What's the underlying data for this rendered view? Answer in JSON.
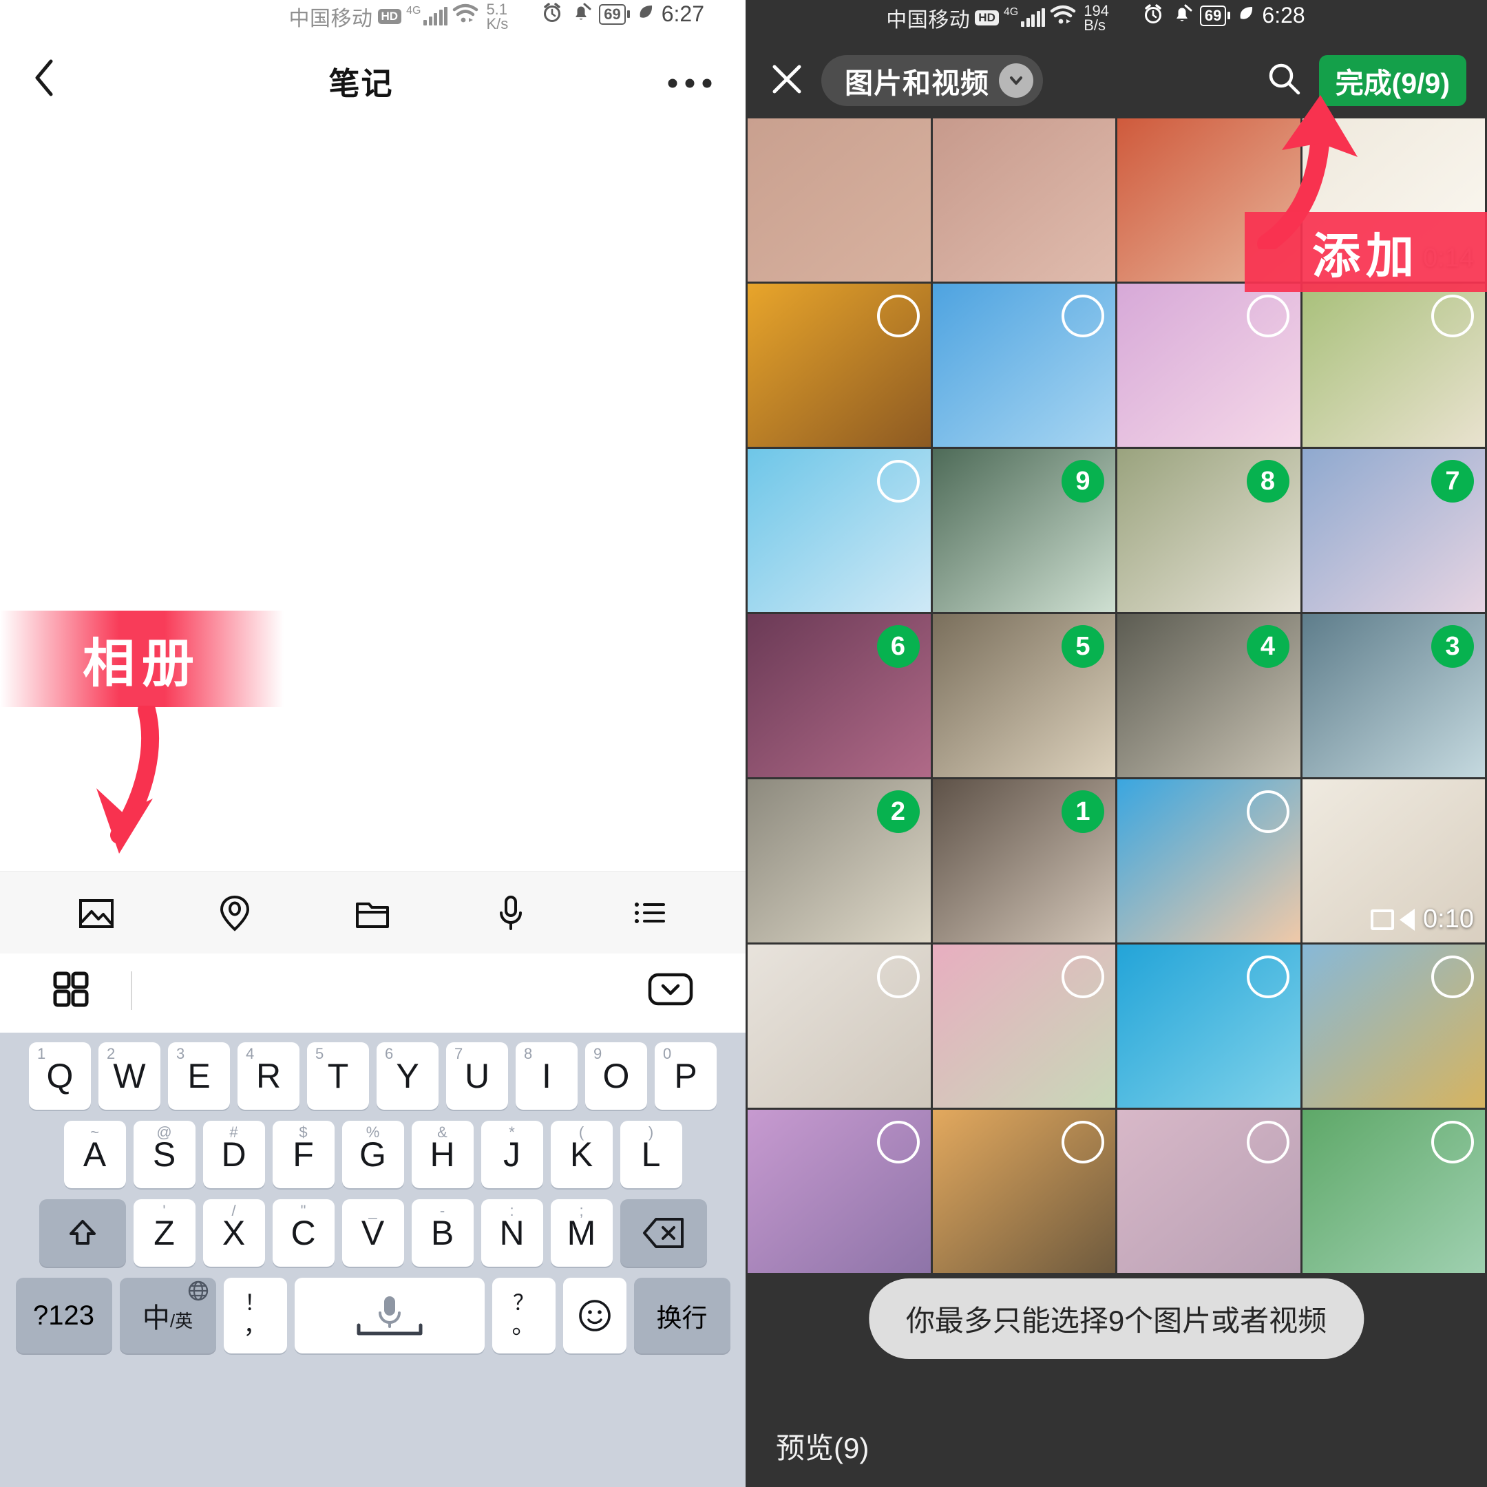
{
  "left_phone": {
    "status_bar": {
      "carrier": "中国移动",
      "hd": "HD",
      "network": "4G",
      "net_speed_value": "5.1",
      "net_speed_unit": "K/s",
      "battery_percent": "69",
      "time": "6:27",
      "icons": [
        "alarm-icon",
        "bell-muted-icon",
        "battery-icon",
        "leaf-icon"
      ]
    },
    "nav": {
      "back_icon": "chevron-left-icon",
      "title": "笔记",
      "more_icon": "more-horizontal-icon"
    },
    "annotation": {
      "album_label": "相册",
      "arrow_color": "#f8324f",
      "band_color": "#f8324f"
    },
    "toolbar": {
      "items": [
        {
          "name": "image-icon",
          "label": "图片"
        },
        {
          "name": "location-icon",
          "label": "位置"
        },
        {
          "name": "folder-icon",
          "label": "文件夹"
        },
        {
          "name": "microphone-icon",
          "label": "语音"
        },
        {
          "name": "list-icon",
          "label": "列表"
        }
      ]
    },
    "toolbar2": {
      "grid_icon": "grid-4-icon",
      "collapse_icon": "chevron-down-box-icon"
    },
    "keyboard": {
      "row1": [
        {
          "sup": "1",
          "key": "Q"
        },
        {
          "sup": "2",
          "key": "W"
        },
        {
          "sup": "3",
          "key": "E"
        },
        {
          "sup": "4",
          "key": "R"
        },
        {
          "sup": "5",
          "key": "T"
        },
        {
          "sup": "6",
          "key": "Y"
        },
        {
          "sup": "7",
          "key": "U"
        },
        {
          "sup": "8",
          "key": "I"
        },
        {
          "sup": "9",
          "key": "O"
        },
        {
          "sup": "0",
          "key": "P"
        }
      ],
      "row2": [
        {
          "sup": "~",
          "key": "A"
        },
        {
          "sup": "@",
          "key": "S"
        },
        {
          "sup": "#",
          "key": "D"
        },
        {
          "sup": "$",
          "key": "F"
        },
        {
          "sup": "%",
          "key": "G"
        },
        {
          "sup": "&",
          "key": "H"
        },
        {
          "sup": "*",
          "key": "J"
        },
        {
          "sup": "(",
          "key": "K"
        },
        {
          "sup": ")",
          "key": "L"
        }
      ],
      "row3": [
        {
          "sup": "'",
          "key": "Z"
        },
        {
          "sup": "/",
          "key": "X"
        },
        {
          "sup": "\"",
          "key": "C"
        },
        {
          "sup": "_",
          "key": "V"
        },
        {
          "sup": "-",
          "key": "B"
        },
        {
          "sup": ":",
          "key": "N"
        },
        {
          "sup": ";",
          "key": "M"
        }
      ],
      "shift_icon": "shift-icon",
      "delete_icon": "backspace-icon",
      "row4": {
        "num_key": "?123",
        "lang_key_main": "中",
        "lang_key_sub": "/英",
        "lang_globe_icon": "globe-icon",
        "comma_top": "！",
        "comma_bottom": "，",
        "space_icon": "microphone-icon",
        "period_top": "？",
        "period_bottom": "。",
        "emoji_icon": "emoji-smile-icon",
        "enter_key": "换行"
      }
    }
  },
  "right_phone": {
    "status_bar": {
      "carrier": "中国移动",
      "hd": "HD",
      "network": "4G",
      "net_speed_value": "194",
      "net_speed_unit": "B/s",
      "battery_percent": "69",
      "time": "6:28",
      "icons": [
        "alarm-icon",
        "bell-muted-icon",
        "battery-icon",
        "leaf-icon"
      ]
    },
    "top_bar": {
      "close_icon": "close-icon",
      "filter_label": "图片和视频",
      "filter_caret_icon": "chevron-down-icon",
      "search_icon": "search-icon",
      "done_label": "完成(9/9)",
      "done_color": "#14a04a"
    },
    "annotation": {
      "add_label": "添加",
      "arrow_color": "#f8324f",
      "band_color": "#f8324f"
    },
    "toast": {
      "message": "你最多只能选择9个图片或者视频"
    },
    "bottom_bar": {
      "preview_label": "预览(9)"
    },
    "grid": {
      "columns": 4,
      "cells": [
        {
          "id": "c1",
          "kind": "photo",
          "badge": null,
          "duration": null,
          "c1": "#c9a08f",
          "c2": "#d8b2a0"
        },
        {
          "id": "c2",
          "kind": "photo",
          "badge": null,
          "duration": null,
          "c1": "#c79a8c",
          "c2": "#e0bcae"
        },
        {
          "id": "c3",
          "kind": "photo",
          "badge": null,
          "duration": null,
          "c1": "#cf5a3c",
          "c2": "#e8b49a"
        },
        {
          "id": "c4",
          "kind": "video",
          "badge": null,
          "duration": "0:14",
          "c1": "#efe9dd",
          "c2": "#fbf8f1"
        },
        {
          "id": "c5",
          "kind": "photo",
          "badge": "off",
          "duration": null,
          "c1": "#e8a52b",
          "c2": "#8d5a22"
        },
        {
          "id": "c6",
          "kind": "photo",
          "badge": "off",
          "duration": null,
          "c1": "#4ea3e0",
          "c2": "#a8d6f2"
        },
        {
          "id": "c7",
          "kind": "photo",
          "badge": "off",
          "duration": null,
          "c1": "#d7a9d8",
          "c2": "#f5d8e8"
        },
        {
          "id": "c8",
          "kind": "photo",
          "badge": "off",
          "duration": null,
          "c1": "#a8c07a",
          "c2": "#e9e2cf"
        },
        {
          "id": "c9",
          "kind": "photo",
          "badge": "off",
          "duration": null,
          "c1": "#6ec6e8",
          "c2": "#cfe9f6"
        },
        {
          "id": "c10",
          "kind": "photo",
          "badge": "9",
          "duration": null,
          "c1": "#4e6b58",
          "c2": "#cfe0d2"
        },
        {
          "id": "c11",
          "kind": "photo",
          "badge": "8",
          "duration": null,
          "c1": "#9aa37e",
          "c2": "#e7e3d6"
        },
        {
          "id": "c12",
          "kind": "photo",
          "badge": "7",
          "duration": null,
          "c1": "#8fa9cf",
          "c2": "#e6d4e2"
        },
        {
          "id": "c13",
          "kind": "photo",
          "badge": "6",
          "duration": null,
          "c1": "#6b3a56",
          "c2": "#b06a88"
        },
        {
          "id": "c14",
          "kind": "photo",
          "badge": "5",
          "duration": null,
          "c1": "#7a6f5c",
          "c2": "#ddd2bd"
        },
        {
          "id": "c15",
          "kind": "photo",
          "badge": "4",
          "duration": null,
          "c1": "#5c5c52",
          "c2": "#c9c3b4"
        },
        {
          "id": "c16",
          "kind": "photo",
          "badge": "3",
          "duration": null,
          "c1": "#5e7d8b",
          "c2": "#c5d9df"
        },
        {
          "id": "c17",
          "kind": "photo",
          "badge": "2",
          "duration": null,
          "c1": "#8d8a7e",
          "c2": "#ded8c8"
        },
        {
          "id": "c18",
          "kind": "photo",
          "badge": "1",
          "duration": null,
          "c1": "#5e5248",
          "c2": "#d3c6b8"
        },
        {
          "id": "c19",
          "kind": "photo",
          "badge": "off",
          "duration": null,
          "c1": "#3aa6e0",
          "c2": "#f0c9a8"
        },
        {
          "id": "c20",
          "kind": "video",
          "badge": null,
          "duration": "0:10",
          "c1": "#efeae0",
          "c2": "#d9cfc0"
        },
        {
          "id": "c21",
          "kind": "photo",
          "badge": "off",
          "duration": null,
          "c1": "#e8e3dc",
          "c2": "#cfc7bc"
        },
        {
          "id": "c22",
          "kind": "photo",
          "badge": "off",
          "duration": null,
          "c1": "#e8aec0",
          "c2": "#c8d8b8"
        },
        {
          "id": "c23",
          "kind": "photo",
          "badge": "off",
          "duration": null,
          "c1": "#23a4d8",
          "c2": "#7fd2ea"
        },
        {
          "id": "c24",
          "kind": "photo",
          "badge": "off",
          "duration": null,
          "c1": "#87b8d8",
          "c2": "#d6b460"
        },
        {
          "id": "c25",
          "kind": "photo",
          "badge": "off",
          "duration": null,
          "c1": "#c79ad0",
          "c2": "#8e74a8"
        },
        {
          "id": "c26",
          "kind": "photo",
          "badge": "off",
          "duration": null,
          "c1": "#e3a95e",
          "c2": "#6e5a3e"
        },
        {
          "id": "c27",
          "kind": "photo",
          "badge": "off",
          "duration": null,
          "c1": "#d8b8c8",
          "c2": "#b8a0b4"
        },
        {
          "id": "c28",
          "kind": "photo",
          "badge": "off",
          "duration": null,
          "c1": "#5ea868",
          "c2": "#9fd0b0"
        }
      ]
    }
  }
}
